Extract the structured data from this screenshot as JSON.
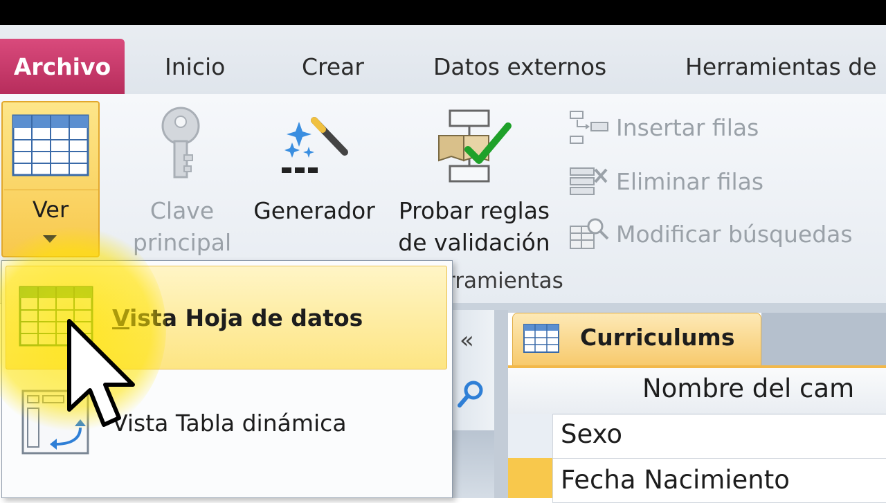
{
  "tabs": {
    "file": "Archivo",
    "home": "Inicio",
    "create": "Crear",
    "external": "Datos externos",
    "tools": "Herramientas de"
  },
  "ribbon": {
    "view_label": "Ver",
    "primary_key_line1": "Clave",
    "primary_key_line2": "principal",
    "builder": "Generador",
    "test_rules_line1": "Probar reglas",
    "test_rules_line2": "de validación",
    "insert_rows": "Insertar filas",
    "delete_rows": "Eliminar filas",
    "modify_lookups": "Modificar búsquedas",
    "group_label": "rramientas"
  },
  "view_menu": {
    "items": [
      {
        "prefix": "V",
        "rest": "ista Hoja de datos",
        "icon": "datasheet-icon"
      },
      {
        "prefix": "",
        "rest": "Vista Tabla dinámica",
        "icon": "pivot-table-icon"
      }
    ]
  },
  "navpane": {
    "collapse": "«"
  },
  "document": {
    "tab_label": "Curriculums",
    "column_header": "Nombre del cam",
    "rows": [
      "Sexo",
      "Fecha Nacimiento"
    ]
  },
  "colors": {
    "file_tab": "#c73565",
    "highlight": "#f8c84c",
    "red_bar": "#e8200f"
  }
}
